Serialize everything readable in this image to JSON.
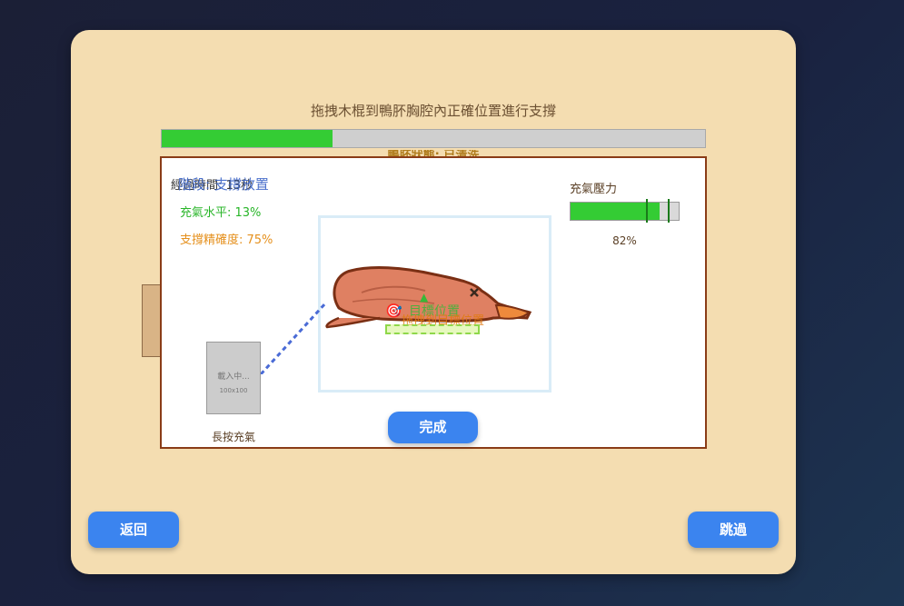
{
  "instruction": "拖拽木棍到鴨肧胸腔內正確位置進行支撐",
  "progress": {
    "value": 0.315
  },
  "stage_status": "鴨肧狀態: 已清洗",
  "panel": {
    "elapsed_label": "經過時間: 13秒",
    "stage_title": "階段: 支撐放置",
    "inflate_level": "充氣水平: 13%",
    "support_accuracy": "支撐精確度: 75%"
  },
  "pressure": {
    "title": "充氣壓力",
    "value_text": "82%",
    "fill": 0.82
  },
  "target": {
    "icon": "🎯",
    "title": "目標位置",
    "hint": "拖拽到目標位置",
    "arrow": "▲"
  },
  "stick": {
    "loading_text": "載入中...",
    "size_text": "100x100",
    "label": "長按充氣"
  },
  "buttons": {
    "done": "完成",
    "back": "返回",
    "skip": "跳過"
  },
  "colors": {
    "accent": "#3b84ef",
    "progress": "#34cc34",
    "panel_border": "#8a3c17"
  }
}
